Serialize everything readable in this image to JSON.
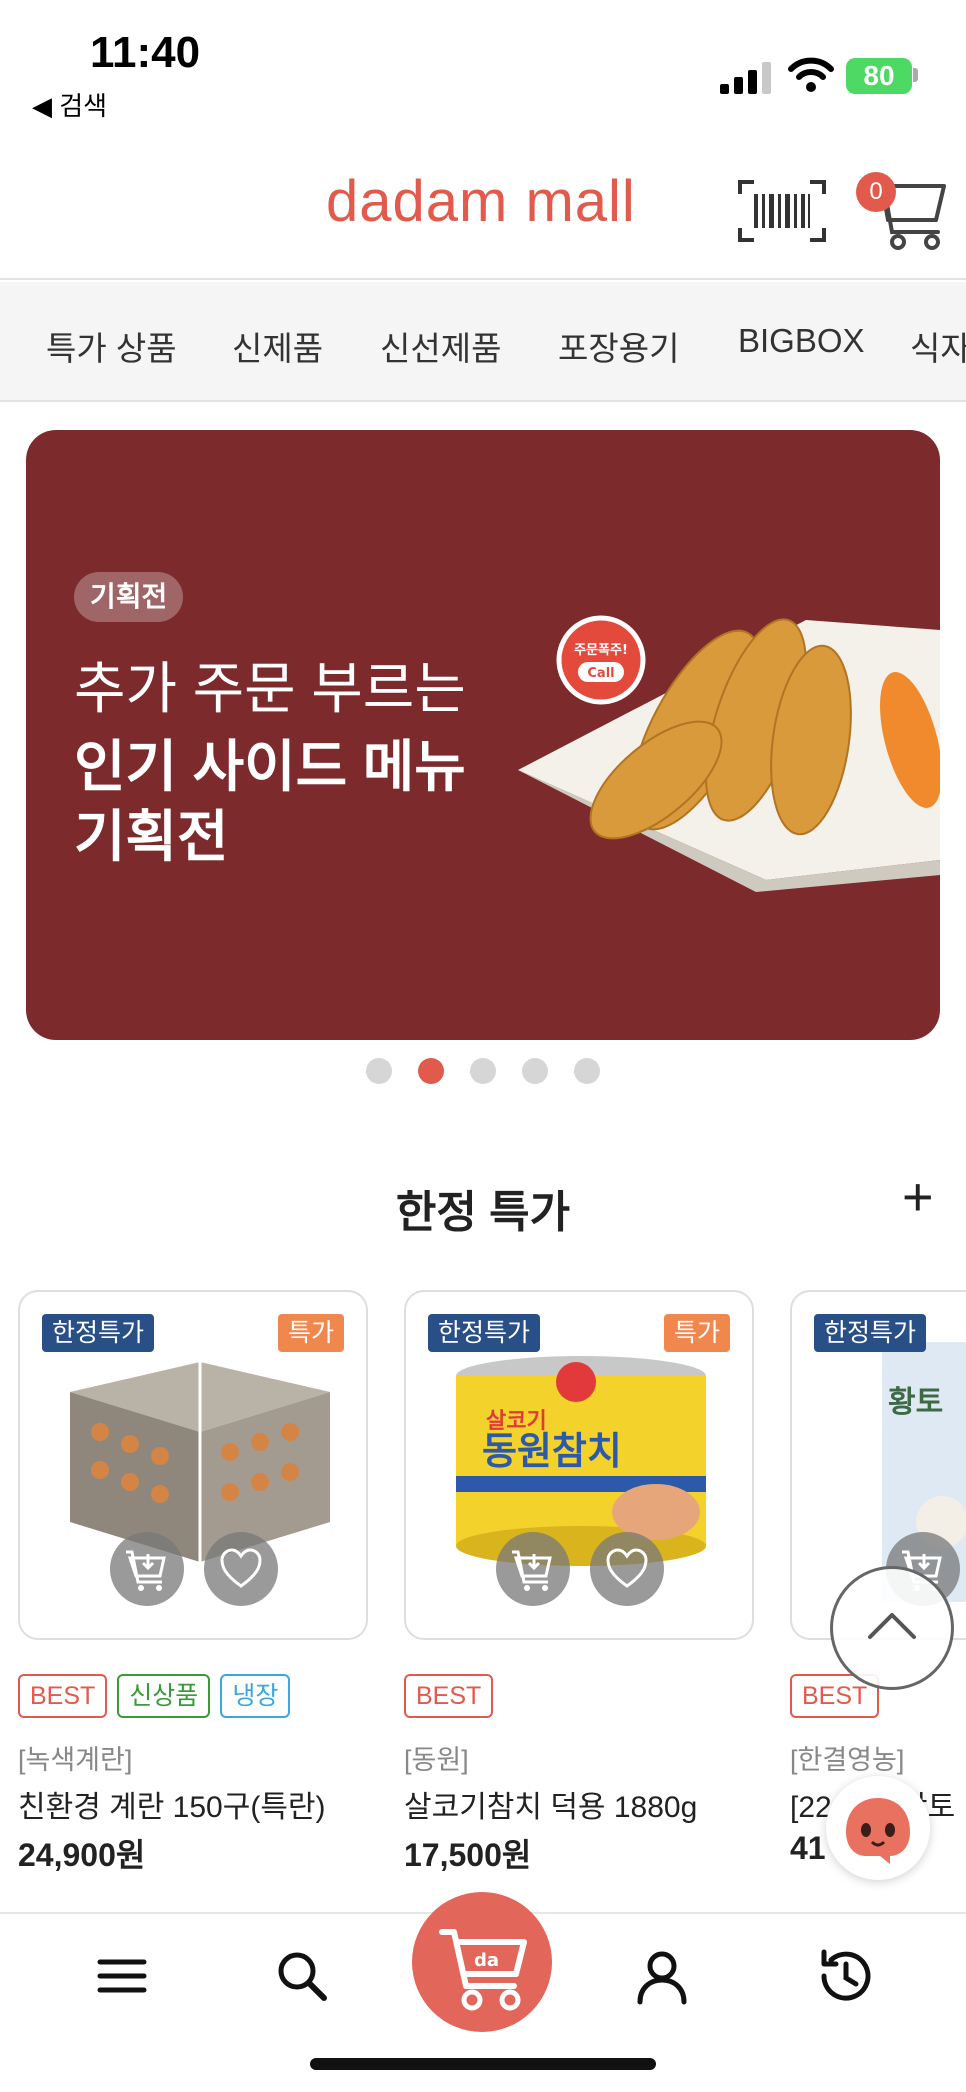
{
  "status": {
    "time": "11:40",
    "back_label": "◀ 검색",
    "battery": "80"
  },
  "header": {
    "logo": "dadam mall",
    "cart_count": "0"
  },
  "categories": [
    "특가 상품",
    "신제품",
    "신선제품",
    "포장용기",
    "BIGBOX",
    "식자"
  ],
  "banner": {
    "tag": "기획전",
    "line1": "추가 주문 부르는",
    "line2": "인기 사이드 메뉴",
    "line3": "기획전",
    "sticker": "주문폭주! Call",
    "bg_color": "#7c2a2c",
    "page_index": 2,
    "page_count": 5
  },
  "section": {
    "title": "한정 특가",
    "more_label": "+"
  },
  "products": [
    {
      "badge_limit": "한정특가",
      "badge_sale": "특가",
      "tags": [
        "BEST",
        "신상품",
        "냉장"
      ],
      "brand": "[녹색계란]",
      "name": "친환경 계란 150구(특란)",
      "price": "24,900원"
    },
    {
      "badge_limit": "한정특가",
      "badge_sale": "특가",
      "tags": [
        "BEST"
      ],
      "brand": "[동원]",
      "name": "살코기참치 덕용 1880g",
      "price": "17,500원"
    },
    {
      "badge_limit": "한정특가",
      "badge_sale": "",
      "tags": [
        "BEST"
      ],
      "brand": "[한결영농]",
      "name": "[22",
      "name_tail": "]황토",
      "price": "41"
    }
  ],
  "colors": {
    "accent": "#e25a4b",
    "limit_badge": "#284f86",
    "sale_badge": "#f0884e"
  },
  "bottom_nav": [
    "menu-icon",
    "search-icon",
    "cart-logo-icon",
    "user-icon",
    "history-icon"
  ]
}
